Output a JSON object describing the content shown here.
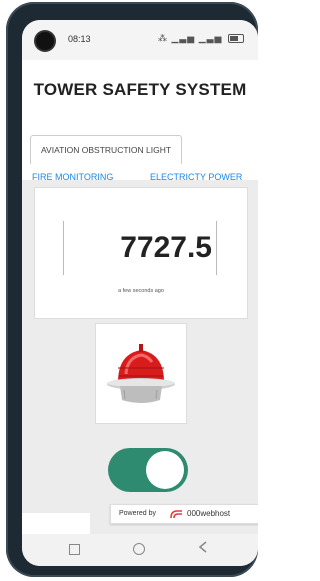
{
  "status": {
    "time": "08:13"
  },
  "header": {
    "title": "TOWER SAFETY SYSTEM"
  },
  "tabs": {
    "active": "AVIATION OBSTRUCTION LIGHT",
    "links": [
      "FIRE MONITORING",
      "ELECTRICTY POWER"
    ]
  },
  "reading": {
    "value": "7727.5",
    "updated": "a few seconds ago"
  },
  "toggle": {
    "state": "on",
    "color": "#2e8b6f"
  },
  "footer": {
    "powered_by": "Powered by",
    "host": "000webhost"
  },
  "colors": {
    "link": "#1e88e5",
    "beacon": "#d81b1b"
  }
}
